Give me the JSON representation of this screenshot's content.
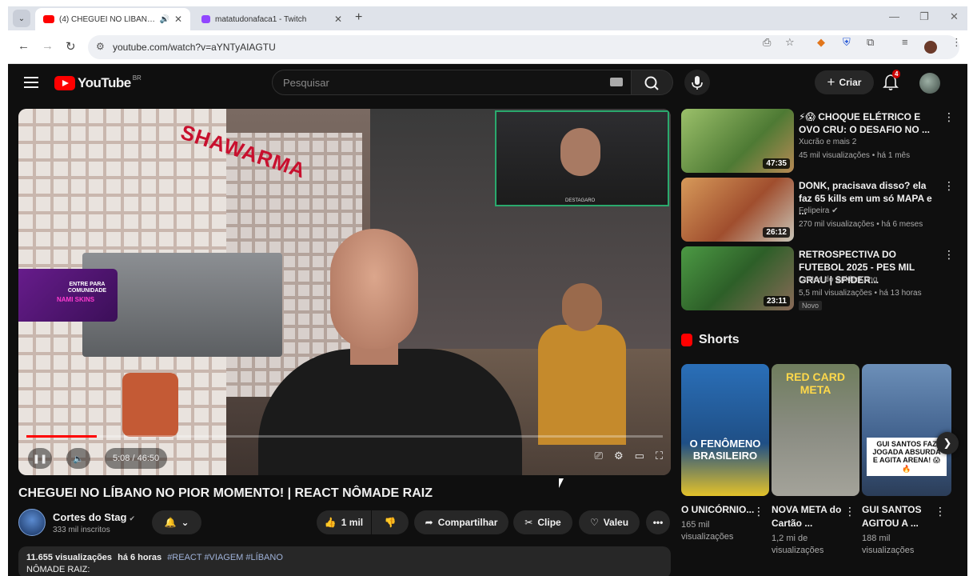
{
  "browser": {
    "tabs": [
      {
        "title": "(4) CHEGUEI NO LÍBANO N",
        "active": true,
        "favicon_color": "#ff0000"
      },
      {
        "title": "matatudonafaca1 - Twitch",
        "active": false,
        "favicon_color": "#9146ff"
      }
    ],
    "url": "youtube.com/watch?v=aYNTyAIAGTU"
  },
  "yt": {
    "logo_text": "YouTube",
    "country": "BR",
    "search_placeholder": "Pesquisar",
    "create_label": "Criar",
    "notification_count": "4"
  },
  "player": {
    "time": "5:08 / 46:50",
    "progress": 0.11,
    "promo_line1": "ENTRE PARA COMUNIDADE",
    "promo_line2": "NAMI SKINS",
    "cam_tag": "DESTAGARO",
    "sign_text": "SHAWARMA"
  },
  "video": {
    "title": "CHEGUEI NO LÍBANO NO PIOR MOMENTO! | REACT NÔMADE RAIZ",
    "channel": "Cortes do Stag",
    "subscribers": "333 mil inscritos",
    "likes": "1 mil",
    "share_label": "Compartilhar",
    "clip_label": "Clipe",
    "thanks_label": "Valeu",
    "views": "11.655 visualizações",
    "age": "há 6 horas",
    "tags": "#REACT #VIAGEM #LÍBANO",
    "desc_line2": "NÔMADE RAIZ:"
  },
  "recommendations": [
    {
      "title": "⚡😱 CHOQUE ELÉTRICO E OVO CRU: O DESAFIO NO ...",
      "channel": "Xucrão e mais 2",
      "meta": "45 mil visualizações • há 1 mês",
      "duration": "47:35",
      "thumb": "#6f9a4a",
      "novo": ""
    },
    {
      "title": "DONK, pracisava disso? ela faz 65 kills em um só MAPA e ...",
      "channel": "Felipeira",
      "meta": "270 mil visualizações • há 6 meses",
      "duration": "26:12",
      "thumb": "#c46a3d",
      "novo": ""
    },
    {
      "title": "RETROSPECTIVA DO FUTEBOL 2025 - PES MIL GRAU | SPIDER...",
      "channel": "Cortes do SpiderKong",
      "meta": "5,5 mil visualizações • há 13 horas",
      "duration": "23:11",
      "thumb": "#3f7d3a",
      "novo": "Novo"
    }
  ],
  "shorts": {
    "header": "Shorts",
    "items": [
      {
        "title": "O UNICÓRNIO...",
        "views": "165 mil visualizações",
        "overlay": "O FENÔMENO BRASILEIRO",
        "bg": "#2a6fb8"
      },
      {
        "title": "NOVA META do Cartão ...",
        "views": "1,2 mi de visualizações",
        "overlay": "RED CARD META",
        "bg": "#7b8a6a"
      },
      {
        "title": "GUI SANTOS AGITOU A ...",
        "views": "188 mil visualizações",
        "overlay": "GUI SANTOS FAZ JOGADA ABSURDA E AGITA ARENA! 😱🔥",
        "bg": "#5a7fb0"
      }
    ]
  }
}
